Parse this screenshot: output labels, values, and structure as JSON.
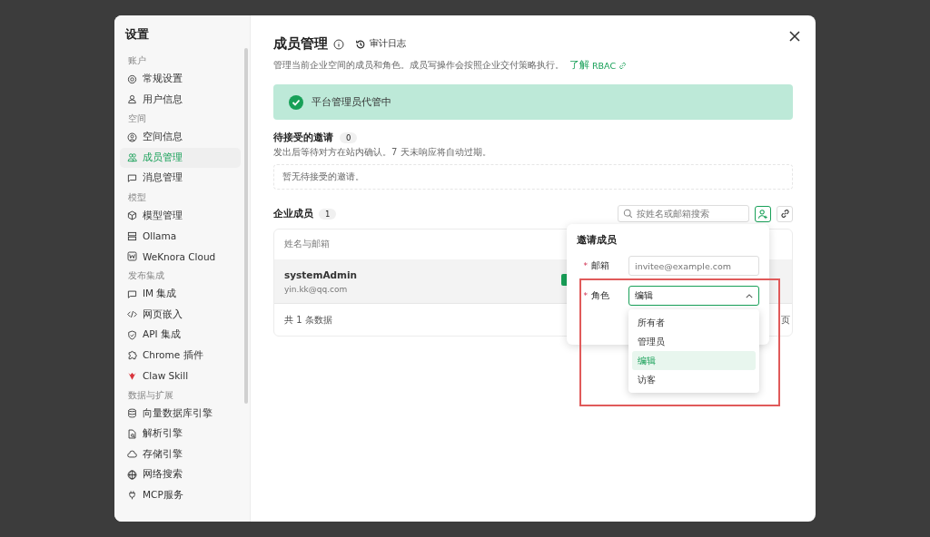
{
  "sidebar": {
    "title": "设置",
    "groups": [
      {
        "label": "账户",
        "items": [
          {
            "label": "常规设置",
            "selected": false
          },
          {
            "label": "用户信息",
            "selected": false
          }
        ]
      },
      {
        "label": "空间",
        "items": [
          {
            "label": "空间信息",
            "selected": false
          },
          {
            "label": "成员管理",
            "selected": true
          },
          {
            "label": "消息管理",
            "selected": false
          }
        ]
      },
      {
        "label": "模型",
        "items": [
          {
            "label": "模型管理",
            "selected": false
          },
          {
            "label": "Ollama",
            "selected": false
          },
          {
            "label": "WeKnora Cloud",
            "selected": false
          }
        ]
      },
      {
        "label": "发布集成",
        "items": [
          {
            "label": "IM 集成",
            "selected": false
          },
          {
            "label": "网页嵌入",
            "selected": false
          },
          {
            "label": "API 集成",
            "selected": false
          },
          {
            "label": "Chrome 插件",
            "selected": false
          },
          {
            "label": "Claw Skill",
            "selected": false
          }
        ]
      },
      {
        "label": "数据与扩展",
        "items": [
          {
            "label": "向量数据库引擎",
            "selected": false
          },
          {
            "label": "解析引擎",
            "selected": false
          },
          {
            "label": "存储引擎",
            "selected": false
          },
          {
            "label": "网络搜索",
            "selected": false
          },
          {
            "label": "MCP服务",
            "selected": false
          }
        ]
      }
    ]
  },
  "header": {
    "title": "成员管理",
    "audit_link": "审计日志",
    "description": "管理当前企业空间的成员和角色。成员写操作会按照企业交付策略执行。",
    "learn_link": "了解",
    "rbac_link": "RBAC"
  },
  "alert": {
    "text": "平台管理员代管中"
  },
  "invitations": {
    "title": "待接受的邀请",
    "count": "0",
    "hint": "发出后等待对方在站内确认。7 天未响应将自动过期。",
    "empty": "暂无待接受的邀请。"
  },
  "members": {
    "title": "企业成员",
    "count": "1",
    "search": {
      "placeholder": "按姓名或邮箱搜索"
    },
    "table": {
      "columns": [
        "姓名与邮箱"
      ],
      "rows": [
        {
          "name": "systemAdmin",
          "email": "yin.kk@qq.com"
        }
      ],
      "footer": "共 1 条数据",
      "pager_fragment": "页"
    }
  },
  "invite_popover": {
    "title": "邀请成员",
    "email_required_mark": "*",
    "email_label": "邮箱",
    "role_required_mark": "*",
    "email": {
      "placeholder": "invitee@example.com"
    },
    "role_label": "角色",
    "role_value": "编辑",
    "expanded": true,
    "options": [
      {
        "label": "所有者",
        "selected": false
      },
      {
        "label": "管理员",
        "selected": false
      },
      {
        "label": "编辑",
        "selected": true
      },
      {
        "label": "访客",
        "selected": false
      }
    ]
  }
}
